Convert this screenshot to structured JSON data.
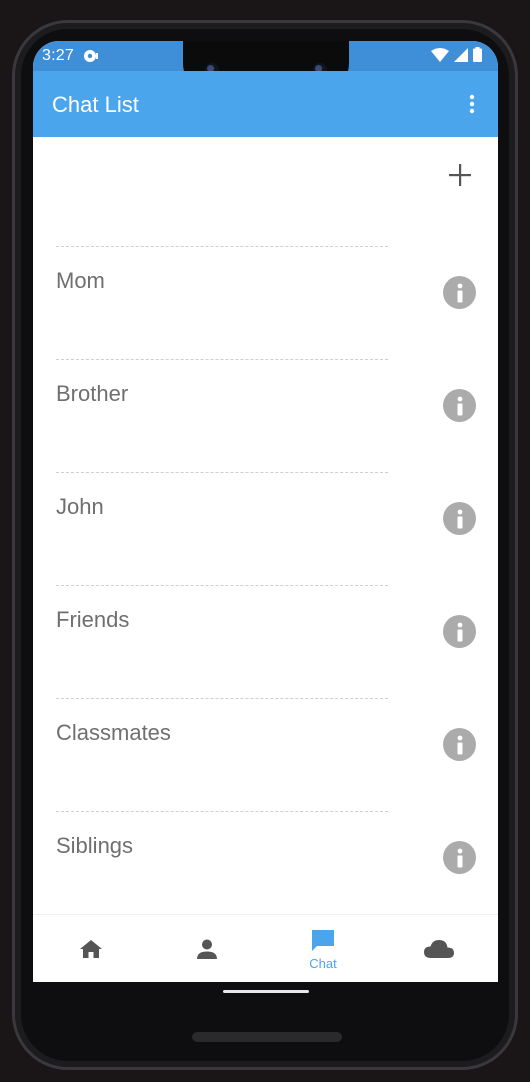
{
  "status_bar": {
    "time": "3:27",
    "icons": [
      "notification-icon",
      "wifi-icon",
      "signal-icon",
      "battery-icon"
    ]
  },
  "app_bar": {
    "title": "Chat List",
    "menu_icon": "more-vertical-icon"
  },
  "toolbar": {
    "add_icon": "plus-icon"
  },
  "chats": [
    {
      "name": "Mom",
      "info_icon": "info-icon"
    },
    {
      "name": "Brother",
      "info_icon": "info-icon"
    },
    {
      "name": "John",
      "info_icon": "info-icon"
    },
    {
      "name": "Friends",
      "info_icon": "info-icon"
    },
    {
      "name": "Classmates",
      "info_icon": "info-icon"
    },
    {
      "name": "Siblings",
      "info_icon": "info-icon"
    }
  ],
  "bottom_nav": {
    "items": [
      {
        "icon": "home-icon",
        "label": "",
        "active": false
      },
      {
        "icon": "person-icon",
        "label": "",
        "active": false
      },
      {
        "icon": "chat-icon",
        "label": "Chat",
        "active": true
      },
      {
        "icon": "cloud-icon",
        "label": "",
        "active": false
      }
    ]
  },
  "colors": {
    "app_bar": "#4aa5ec",
    "status_bar": "#3f8fd8",
    "accent": "#4aa5ec",
    "inactive_icon": "#555555",
    "info_icon_bg": "#ababab",
    "chat_name_text": "#6f6f6f"
  }
}
